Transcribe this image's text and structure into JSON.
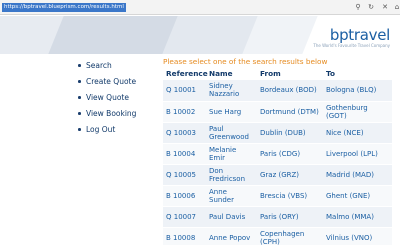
{
  "browser": {
    "url": "https://bptravel.blueprism.com/results.html",
    "icons": [
      "search-icon",
      "refresh-icon",
      "close-icon",
      "home-icon"
    ]
  },
  "header": {
    "logo": "bptravel",
    "tagline": "The World's Favourite Travel Company"
  },
  "nav": {
    "items": [
      {
        "label": "Search"
      },
      {
        "label": "Create Quote"
      },
      {
        "label": "View Quote"
      },
      {
        "label": "View Booking"
      },
      {
        "label": "Log Out"
      }
    ]
  },
  "main": {
    "prompt": "Please select one of the search results below",
    "columns": [
      "Reference",
      "Name",
      "From",
      "To"
    ],
    "rows": [
      {
        "ref": "Q 10001",
        "name": "Sidney Nazzario",
        "from": "Bordeaux (BOD)",
        "to": "Bologna (BLQ)"
      },
      {
        "ref": "B 10002",
        "name": "Sue Harg",
        "from": "Dortmund (DTM)",
        "to": "Gothenburg (GOT)"
      },
      {
        "ref": "Q 10003",
        "name": "Paul Greenwood",
        "from": "Dublin (DUB)",
        "to": "Nice (NCE)"
      },
      {
        "ref": "B 10004",
        "name": "Melanie Emir",
        "from": "Paris (CDG)",
        "to": "Liverpool (LPL)"
      },
      {
        "ref": "Q 10005",
        "name": "Don Fredricson",
        "from": "Graz (GRZ)",
        "to": "Madrid (MAD)"
      },
      {
        "ref": "B 10006",
        "name": "Anne Sunder",
        "from": "Brescia (VBS)",
        "to": "Ghent (GNE)"
      },
      {
        "ref": "Q 10007",
        "name": "Paul Davis",
        "from": "Paris (ORY)",
        "to": "Malmo (MMA)"
      },
      {
        "ref": "B 10008",
        "name": "Anne Popov",
        "from": "Copenhagen (CPH)",
        "to": "Vilnius (VNO)"
      }
    ]
  },
  "colors": {
    "accent": "#1b5fa3",
    "prompt": "#e58a1f",
    "nav_text": "#123a6a",
    "row_shade": "#eef2f7"
  }
}
